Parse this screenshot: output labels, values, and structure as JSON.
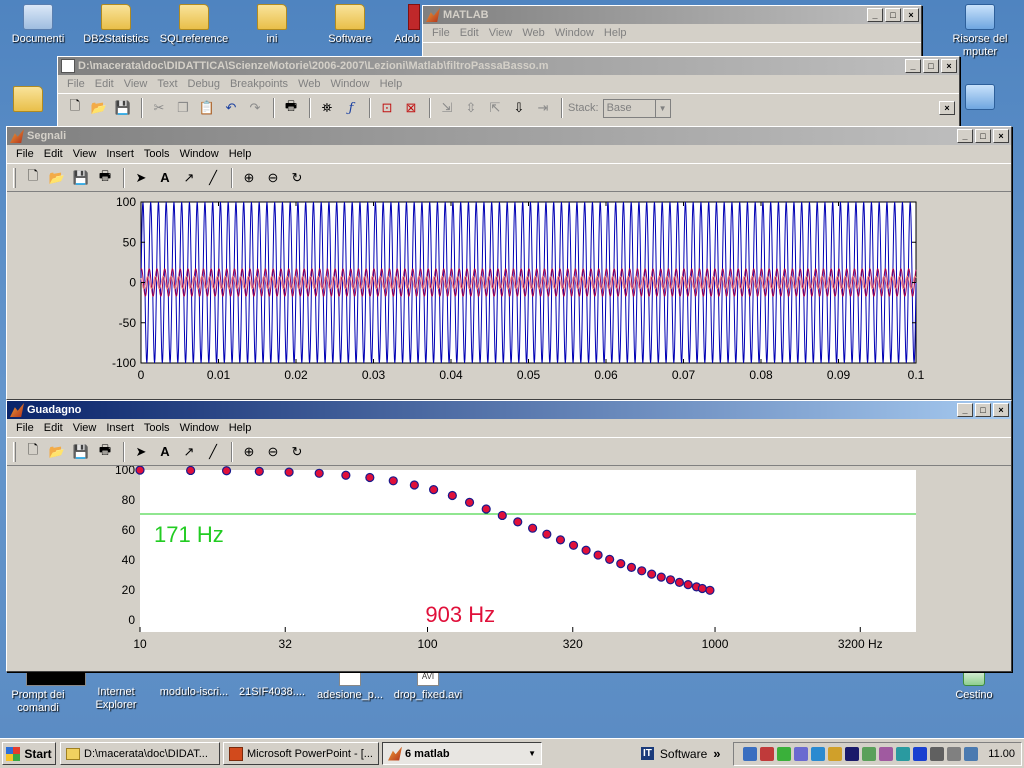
{
  "desktop": {
    "icons_top": [
      "Documenti",
      "DB2Statistics",
      "SQLreference",
      "ini",
      "Software",
      "Adob"
    ],
    "icon_right": "Risorse del\nmputer",
    "icons_bottom": [
      "Prompt dei\ncomandi",
      "Internet\nExplorer",
      "modulo-iscri...",
      "21SIF4038....",
      "adesione_p...",
      "drop_fixed.avi"
    ],
    "recycle": "Cestino",
    "avi_badge": "AVI"
  },
  "matlab_main": {
    "title": "MATLAB",
    "menu": [
      "File",
      "Edit",
      "View",
      "Web",
      "Window",
      "Help"
    ]
  },
  "editor": {
    "title": "D:\\macerata\\doc\\DIDATTICA\\ScienzeMotorie\\2006-2007\\Lezioni\\Matlab\\filtroPassaBasso.m",
    "menu": [
      "File",
      "Edit",
      "View",
      "Text",
      "Debug",
      "Breakpoints",
      "Web",
      "Window",
      "Help"
    ],
    "stack_label": "Stack:",
    "stack_value": "Base"
  },
  "fig_menu": [
    "File",
    "Edit",
    "View",
    "Insert",
    "Tools",
    "Window",
    "Help"
  ],
  "segnali": {
    "title": "Segnali",
    "chart_data": {
      "type": "line",
      "xlim": [
        0,
        0.1
      ],
      "ylim": [
        -100,
        100
      ],
      "x_ticks": [
        "0",
        "0.01",
        "0.02",
        "0.03",
        "0.04",
        "0.05",
        "0.06",
        "0.07",
        "0.08",
        "0.09",
        "0.1"
      ],
      "y_ticks": [
        "100",
        "50",
        "0",
        "-50",
        "-100"
      ],
      "series": [
        {
          "color": "#0000b4",
          "amplitude": 100,
          "cycles_in_window": 100
        },
        {
          "color": "#a00050",
          "amplitude": 17,
          "cycles_in_window": 100
        },
        {
          "color": "#f08a8a",
          "amplitude": 8,
          "cycles_in_window": 100
        }
      ]
    }
  },
  "guadagno": {
    "title": "Guadagno",
    "annotation_green": "171 Hz",
    "annotation_red": "903 Hz",
    "chart_data": {
      "type": "scatter",
      "xscale": "log",
      "xlim": [
        10,
        5000
      ],
      "ylim": [
        -8,
        100
      ],
      "x_ticks": [
        {
          "v": 10,
          "label": "10"
        },
        {
          "v": 32,
          "label": "32"
        },
        {
          "v": 100,
          "label": "100"
        },
        {
          "v": 320,
          "label": "320"
        },
        {
          "v": 1000,
          "label": "1000"
        },
        {
          "v": 3200,
          "label": "3200 Hz"
        }
      ],
      "y_ticks": [
        100,
        80,
        60,
        40,
        20,
        0
      ],
      "threshold": {
        "y": 70.7,
        "color": "#22cc22"
      },
      "marker_color": "#e0103a",
      "marker_edge": "#1a1a8c",
      "x": [
        10,
        15,
        20,
        26,
        33,
        42,
        52,
        63,
        76,
        90,
        105,
        122,
        140,
        160,
        182,
        206,
        232,
        260,
        290,
        322,
        356,
        392,
        430,
        470,
        512,
        556,
        602,
        650,
        700,
        752,
        806,
        862,
        903,
        960
      ],
      "y": [
        99.9,
        99.7,
        99.5,
        99.1,
        98.6,
        97.8,
        96.5,
        95,
        92.8,
        90,
        86.9,
        83,
        78.4,
        74,
        69.7,
        65.4,
        61.2,
        57.2,
        53.4,
        49.8,
        46.5,
        43.3,
        40.4,
        37.6,
        35.1,
        32.8,
        30.6,
        28.6,
        26.8,
        25.1,
        23.6,
        22.1,
        21,
        19.8
      ]
    }
  },
  "taskbar": {
    "start": "Start",
    "tasks": [
      "D:\\macerata\\doc\\DIDAT...",
      "Microsoft PowerPoint - [...",
      "6 matlab"
    ],
    "tray_it": "IT",
    "tray_app": "Software",
    "tray_arrow": "»",
    "clock": "11.00"
  }
}
